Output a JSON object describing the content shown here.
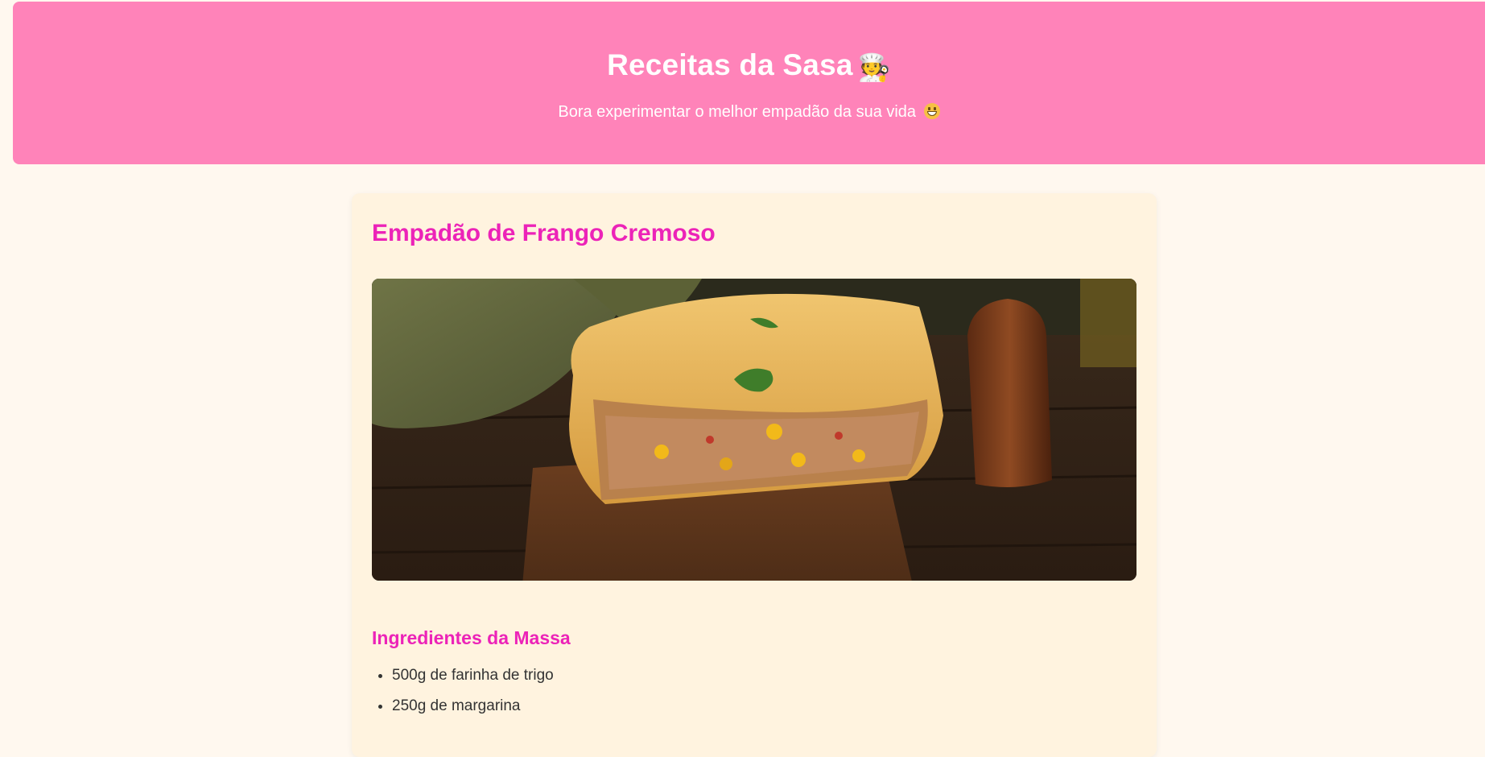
{
  "header": {
    "title": "Receitas da Sasa",
    "chef_emoji": "🧑‍🍳",
    "subtitle": "Bora experimentar o melhor empadão da sua vida"
  },
  "recipe": {
    "title": "Empadão de Frango Cremoso",
    "image_alt": "Empadão de frango",
    "section_title": "Ingredientes da Massa",
    "ingredients": [
      "500g de farinha de trigo",
      "250g de margarina"
    ]
  },
  "colors": {
    "header_bg": "#ff83b9",
    "accent": "#ec23b8",
    "page_bg": "#fff8ef",
    "card_bg": "#fff3df"
  },
  "icons": [
    "chef-icon",
    "grinning-face-icon"
  ]
}
